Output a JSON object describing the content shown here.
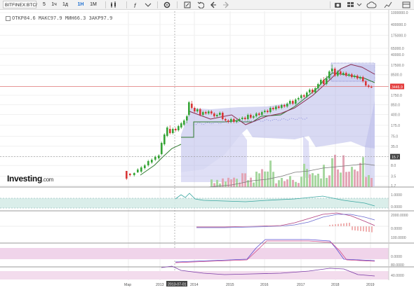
{
  "toolbar": {
    "symbol": "BITFINEX:BTC/",
    "intervals": [
      "5",
      "1ч",
      "1д",
      "1Н",
      "1М"
    ],
    "active_interval": "1Н",
    "icons": [
      "candle-type-icon",
      "indicators-icon",
      "settings-icon",
      "undo-icon",
      "redo-icon",
      "prev-icon",
      "camera-icon",
      "layout-icon",
      "cloud-icon",
      "chart-icon"
    ]
  },
  "legend": {
    "text": "ОТКР84.6 МАКС97.9 МИН66.3 ЗАКР97.9"
  },
  "logo": {
    "brand": "Investing",
    "domain": ".com"
  },
  "colors": {
    "up": "#36a436",
    "down": "#d83636",
    "cloud": "#b8b9ea",
    "ma": "#8a2c50",
    "ind": "#7a7a7a"
  },
  "chart_data": {
    "type": "line",
    "scale": "log",
    "y_ticks": [
      "1000000.0",
      "400000.0",
      "175000.0",
      "65000.0",
      "40000.0",
      "17500.0",
      "8500.0",
      "3446.9",
      "1750.0",
      "850.0",
      "400.0",
      "175.0",
      "75.0",
      "35.0",
      "15.7",
      "8.0",
      "3.5",
      "1.7"
    ],
    "last_price": "3446.9",
    "marker_price": "15.7",
    "x_ticks": [
      "Мар",
      "2013",
      "2013-07-01",
      "2014",
      "2015",
      "2016",
      "2017",
      "2018",
      "2019"
    ],
    "crosshair_label": "2013-07-01",
    "panel_ticks": {
      "p1": [
        "1.0000",
        "0.0000"
      ],
      "p2": [
        "2000.0000",
        "0.0000"
      ],
      "p3": [
        "100.0000",
        "0.0000"
      ],
      "p4": [
        "80.0000",
        "40.0000"
      ]
    }
  }
}
